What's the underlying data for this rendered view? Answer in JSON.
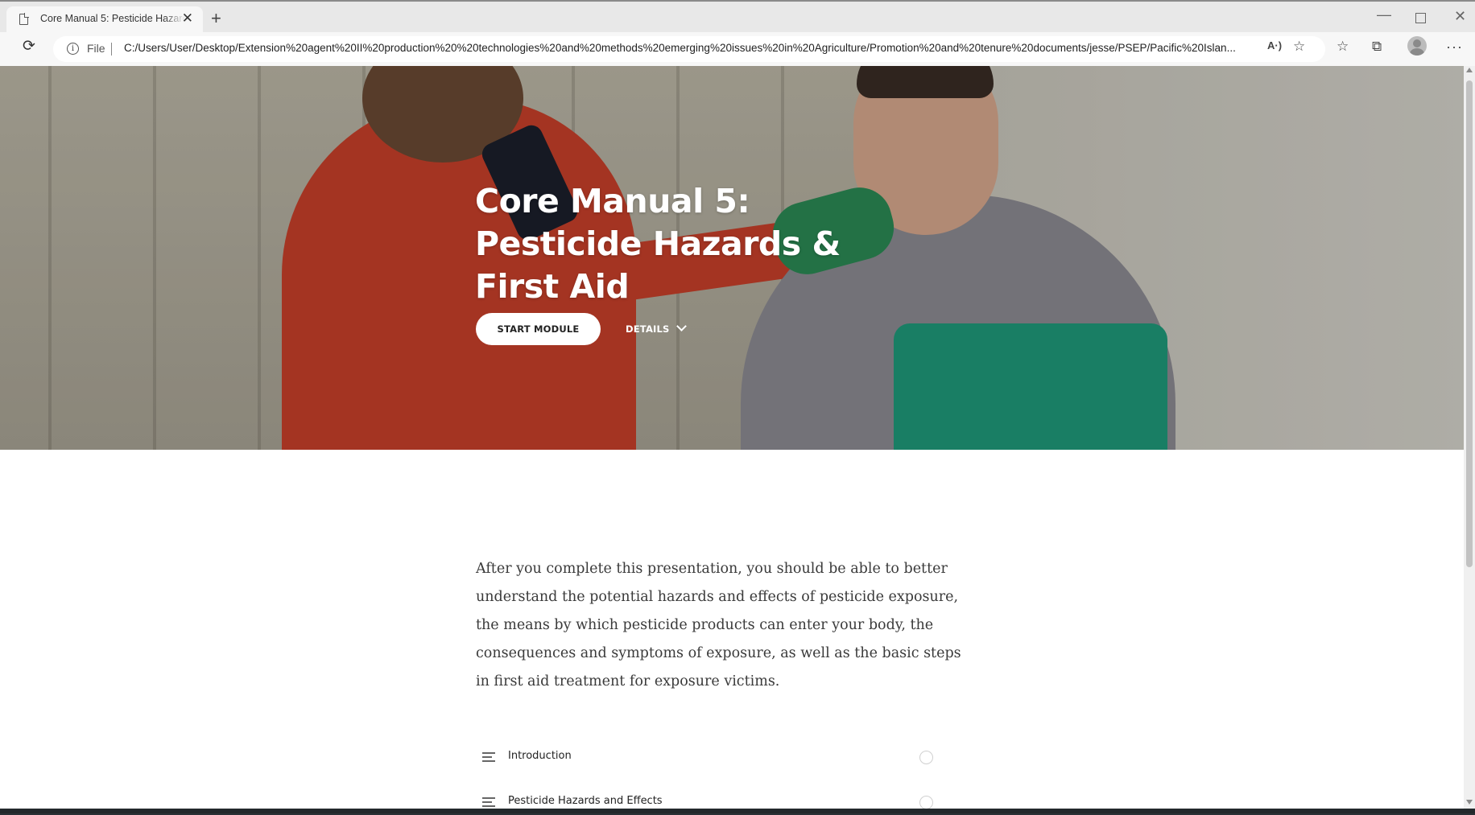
{
  "browser": {
    "tab_title": "Core Manual 5: Pesticide Hazards & First Aid",
    "new_tab_symbol": "+",
    "close_symbol": "✕",
    "address_prefix": "File",
    "url": "C:/Users/User/Desktop/Extension%20agent%20II%20production%20%20technologies%20and%20methods%20emerging%20issues%20in%20Agriculture/Promotion%20and%20tenure%20documents/jesse/PSEP/Pacific%20Islan...",
    "read_aloud_label": "A·)"
  },
  "hero": {
    "title": "Core Manual 5: Pesticide Hazards & First Aid",
    "start_button": "START MODULE",
    "details_button": "DETAILS"
  },
  "content": {
    "intro": "After you complete this presentation, you should be able to better understand the potential hazards and effects of pesticide exposure, the means by which pesticide products can enter your body, the consequences and symptoms of exposure, as well as the basic steps in first aid treatment for exposure victims.",
    "lessons": [
      {
        "label": "Introduction"
      },
      {
        "label": "Pesticide Hazards and Effects"
      }
    ]
  }
}
